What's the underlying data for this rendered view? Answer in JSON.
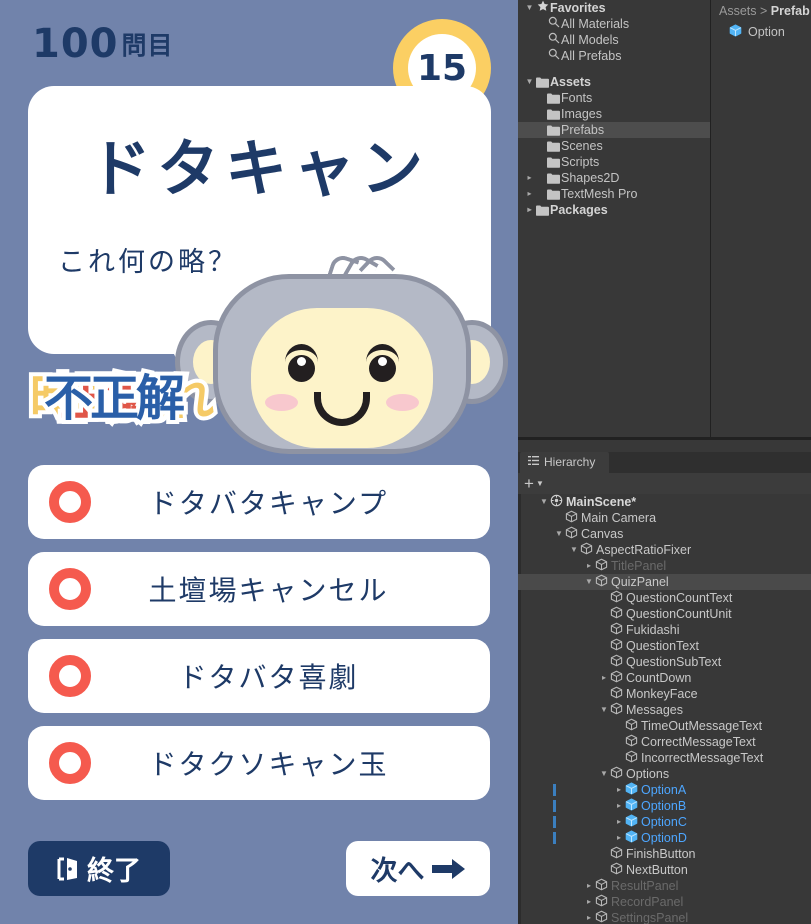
{
  "game": {
    "question_count": "100",
    "question_count_unit": "問目",
    "countdown": "15",
    "question_text": "ドタキャン",
    "question_sub_text": "これ何の略？",
    "messages": {
      "timeout": "時間切れ",
      "correct": "正解",
      "incorrect": "不正解"
    },
    "options": [
      {
        "label": "ドタバタキャンプ"
      },
      {
        "label": "土壇場キャンセル"
      },
      {
        "label": "ドタバタ喜劇"
      },
      {
        "label": "ドタクソキャン玉"
      }
    ],
    "finish_button": "終了",
    "next_button": "次へ",
    "colors": {
      "background": "#7183ab",
      "navy": "#1e3a67",
      "amber": "#fbcf63",
      "radio_red": "#f55a4e"
    }
  },
  "project": {
    "favorites_label": "Favorites",
    "favorites": [
      {
        "label": "All Materials",
        "icon": "search-icon"
      },
      {
        "label": "All Models",
        "icon": "search-icon"
      },
      {
        "label": "All Prefabs",
        "icon": "search-icon"
      }
    ],
    "assets_label": "Assets",
    "assets": [
      {
        "label": "Fonts",
        "expandable": false,
        "selected": false
      },
      {
        "label": "Images",
        "expandable": false,
        "selected": false
      },
      {
        "label": "Prefabs",
        "expandable": false,
        "selected": true
      },
      {
        "label": "Scenes",
        "expandable": false,
        "selected": false
      },
      {
        "label": "Scripts",
        "expandable": false,
        "selected": false
      },
      {
        "label": "Shapes2D",
        "expandable": true,
        "selected": false
      },
      {
        "label": "TextMesh Pro",
        "expandable": true,
        "selected": false
      }
    ],
    "packages_label": "Packages",
    "breadcrumb_root": "Assets",
    "breadcrumb_sep": ">",
    "breadcrumb_current": "Prefab",
    "contents": [
      {
        "label": "Option",
        "icon": "prefab-cube-icon"
      }
    ]
  },
  "hierarchy": {
    "tab_label": "Hierarchy",
    "add_label": "+",
    "rows": [
      {
        "label": "MainScene*",
        "indent": 1,
        "arrow": "down",
        "icon": "scene-icon",
        "style": "bold",
        "selected": false,
        "prefab": false
      },
      {
        "label": "Main Camera",
        "indent": 2,
        "arrow": "none",
        "icon": "gameobject-icon",
        "style": "normal",
        "selected": false,
        "prefab": false
      },
      {
        "label": "Canvas",
        "indent": 2,
        "arrow": "down",
        "icon": "gameobject-icon",
        "style": "normal",
        "selected": false,
        "prefab": false
      },
      {
        "label": "AspectRatioFixer",
        "indent": 3,
        "arrow": "down",
        "icon": "gameobject-icon",
        "style": "normal",
        "selected": false,
        "prefab": false
      },
      {
        "label": "TitlePanel",
        "indent": 4,
        "arrow": "right",
        "icon": "gameobject-icon",
        "style": "dim",
        "selected": false,
        "prefab": false
      },
      {
        "label": "QuizPanel",
        "indent": 4,
        "arrow": "down",
        "icon": "gameobject-icon",
        "style": "normal",
        "selected": true,
        "prefab": false
      },
      {
        "label": "QuestionCountText",
        "indent": 5,
        "arrow": "none",
        "icon": "gameobject-icon",
        "style": "normal",
        "selected": false,
        "prefab": false
      },
      {
        "label": "QuestionCountUnit",
        "indent": 5,
        "arrow": "none",
        "icon": "gameobject-icon",
        "style": "normal",
        "selected": false,
        "prefab": false
      },
      {
        "label": "Fukidashi",
        "indent": 5,
        "arrow": "none",
        "icon": "gameobject-icon",
        "style": "normal",
        "selected": false,
        "prefab": false
      },
      {
        "label": "QuestionText",
        "indent": 5,
        "arrow": "none",
        "icon": "gameobject-icon",
        "style": "normal",
        "selected": false,
        "prefab": false
      },
      {
        "label": "QuestionSubText",
        "indent": 5,
        "arrow": "none",
        "icon": "gameobject-icon",
        "style": "normal",
        "selected": false,
        "prefab": false
      },
      {
        "label": "CountDown",
        "indent": 5,
        "arrow": "right",
        "icon": "gameobject-icon",
        "style": "normal",
        "selected": false,
        "prefab": false
      },
      {
        "label": "MonkeyFace",
        "indent": 5,
        "arrow": "none",
        "icon": "gameobject-icon",
        "style": "normal",
        "selected": false,
        "prefab": false
      },
      {
        "label": "Messages",
        "indent": 5,
        "arrow": "down",
        "icon": "gameobject-icon",
        "style": "normal",
        "selected": false,
        "prefab": false
      },
      {
        "label": "TimeOutMessageText",
        "indent": 6,
        "arrow": "none",
        "icon": "gameobject-icon",
        "style": "normal",
        "selected": false,
        "prefab": false
      },
      {
        "label": "CorrectMessageText",
        "indent": 6,
        "arrow": "none",
        "icon": "gameobject-icon",
        "style": "normal",
        "selected": false,
        "prefab": false
      },
      {
        "label": "IncorrectMessageText",
        "indent": 6,
        "arrow": "none",
        "icon": "gameobject-icon",
        "style": "normal",
        "selected": false,
        "prefab": false
      },
      {
        "label": "Options",
        "indent": 5,
        "arrow": "down",
        "icon": "gameobject-icon",
        "style": "normal",
        "selected": false,
        "prefab": false
      },
      {
        "label": "OptionA",
        "indent": 6,
        "arrow": "right",
        "icon": "prefab-cube-icon",
        "style": "blue",
        "selected": false,
        "prefab": true
      },
      {
        "label": "OptionB",
        "indent": 6,
        "arrow": "right",
        "icon": "prefab-cube-icon",
        "style": "blue",
        "selected": false,
        "prefab": true
      },
      {
        "label": "OptionC",
        "indent": 6,
        "arrow": "right",
        "icon": "prefab-cube-icon",
        "style": "blue",
        "selected": false,
        "prefab": true
      },
      {
        "label": "OptionD",
        "indent": 6,
        "arrow": "right",
        "icon": "prefab-cube-icon",
        "style": "blue",
        "selected": false,
        "prefab": true
      },
      {
        "label": "FinishButton",
        "indent": 5,
        "arrow": "none",
        "icon": "gameobject-icon",
        "style": "normal",
        "selected": false,
        "prefab": false
      },
      {
        "label": "NextButton",
        "indent": 5,
        "arrow": "none",
        "icon": "gameobject-icon",
        "style": "normal",
        "selected": false,
        "prefab": false
      },
      {
        "label": "ResultPanel",
        "indent": 4,
        "arrow": "right",
        "icon": "gameobject-icon",
        "style": "dim",
        "selected": false,
        "prefab": false
      },
      {
        "label": "RecordPanel",
        "indent": 4,
        "arrow": "right",
        "icon": "gameobject-icon",
        "style": "dim",
        "selected": false,
        "prefab": false
      },
      {
        "label": "SettingsPanel",
        "indent": 4,
        "arrow": "right",
        "icon": "gameobject-icon",
        "style": "dim",
        "selected": false,
        "prefab": false
      }
    ],
    "highlight_color": "#f59423"
  }
}
